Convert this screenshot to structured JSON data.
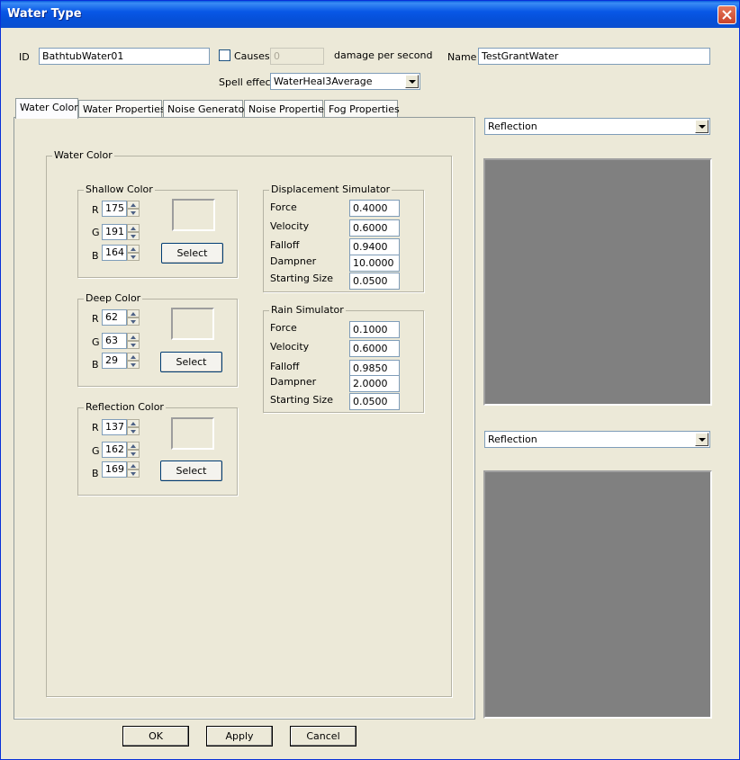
{
  "window": {
    "title": "Water Type"
  },
  "header": {
    "id_label": "ID",
    "id_value": "BathtubWater01",
    "causes_label": "Causes",
    "causes_value": "0",
    "damage_label": "damage per second",
    "name_label": "Name",
    "name_value": "TestGrantWater",
    "spell_label": "Spell effect",
    "spell_value": "WaterHeal3Average"
  },
  "tabs": [
    {
      "label": "Water Color",
      "active": true
    },
    {
      "label": "Water Properties",
      "active": false
    },
    {
      "label": "Noise Generator",
      "active": false
    },
    {
      "label": "Noise Properties",
      "active": false
    },
    {
      "label": "Fog Properties",
      "active": false
    }
  ],
  "water_color": {
    "title": "Water Color",
    "shallow": {
      "title": "Shallow Color",
      "r_label": "R",
      "g_label": "G",
      "b_label": "B",
      "r": "175",
      "g": "191",
      "b": "164",
      "select": "Select"
    },
    "deep": {
      "title": "Deep Color",
      "r_label": "R",
      "g_label": "G",
      "b_label": "B",
      "r": "62",
      "g": "63",
      "b": "29",
      "select": "Select"
    },
    "reflection": {
      "title": "Reflection Color",
      "r_label": "R",
      "g_label": "G",
      "b_label": "B",
      "r": "137",
      "g": "162",
      "b": "169",
      "select": "Select"
    },
    "displacement": {
      "title": "Displacement Simulator",
      "force_label": "Force",
      "force": "0.4000",
      "velocity_label": "Velocity",
      "velocity": "0.6000",
      "falloff_label": "Falloff",
      "falloff": "0.9400",
      "dampner_label": "Dampner",
      "dampner": "10.0000",
      "size_label": "Starting Size",
      "size": "0.0500"
    },
    "rain": {
      "title": "Rain Simulator",
      "force_label": "Force",
      "force": "0.1000",
      "velocity_label": "Velocity",
      "velocity": "0.6000",
      "falloff_label": "Falloff",
      "falloff": "0.9850",
      "dampner_label": "Dampner",
      "dampner": "2.0000",
      "size_label": "Starting Size",
      "size": "0.0500"
    }
  },
  "preview": {
    "top_select": "Reflection",
    "bottom_select": "Reflection"
  },
  "footer": {
    "ok": "OK",
    "apply": "Apply",
    "cancel": "Cancel"
  }
}
